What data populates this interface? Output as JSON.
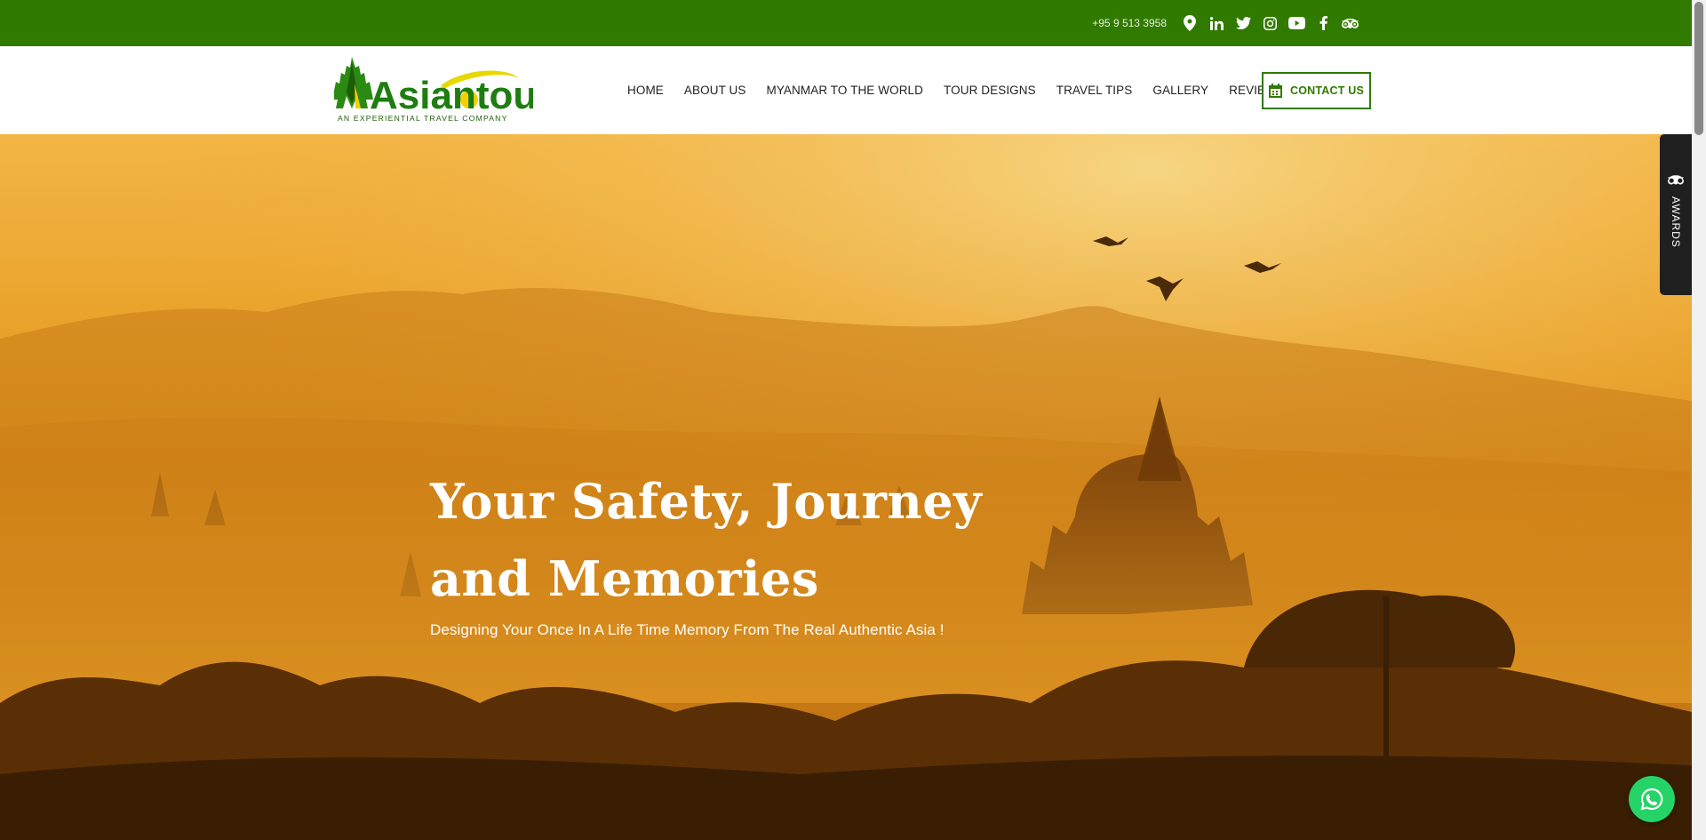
{
  "topbar": {
    "phone": "+95 9 513 3958",
    "icons": [
      "location-icon",
      "linkedin-icon",
      "twitter-icon",
      "instagram-icon",
      "youtube-icon",
      "facebook-icon",
      "tripadvisor-icon"
    ]
  },
  "logo": {
    "text": "Asiantour",
    "tagline": "AN EXPERIENTIAL TRAVEL COMPANY"
  },
  "nav": {
    "items": [
      "HOME",
      "ABOUT US",
      "MYANMAR TO THE WORLD",
      "TOUR DESIGNS",
      "TRAVEL TIPS",
      "GALLERY",
      "REVIEWS"
    ],
    "contact_label": "CONTACT US"
  },
  "hero": {
    "title_line1": "Your Safety, Journey",
    "title_line2": "and Memories",
    "subtitle": "Designing Your Once In A Life Time Memory From The Real Authentic Asia !"
  },
  "awards": {
    "label": "AWARDS"
  },
  "colors": {
    "brand_green": "#317a00",
    "whatsapp_green": "#25d366"
  }
}
